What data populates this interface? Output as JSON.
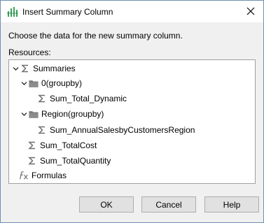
{
  "window": {
    "title": "Insert Summary Column"
  },
  "instruction": "Choose the data for the new summary column.",
  "resources_label": "Resources:",
  "tree": {
    "summaries": "Summaries",
    "group0": "0(groupby)",
    "sum_total_dynamic": "Sum_Total_Dynamic",
    "region_group": "Region(groupby)",
    "sum_annual": "Sum_AnnualSalesbyCustomersRegion",
    "sum_totalcost": "Sum_TotalCost",
    "sum_totalquantity": "Sum_TotalQuantity",
    "formulas": "Formulas"
  },
  "buttons": {
    "ok": "OK",
    "cancel": "Cancel",
    "help": "Help"
  },
  "colors": {
    "accent": "#2e8b57",
    "folder": "#7a7a7a",
    "sigma": "#6f6f6f"
  }
}
